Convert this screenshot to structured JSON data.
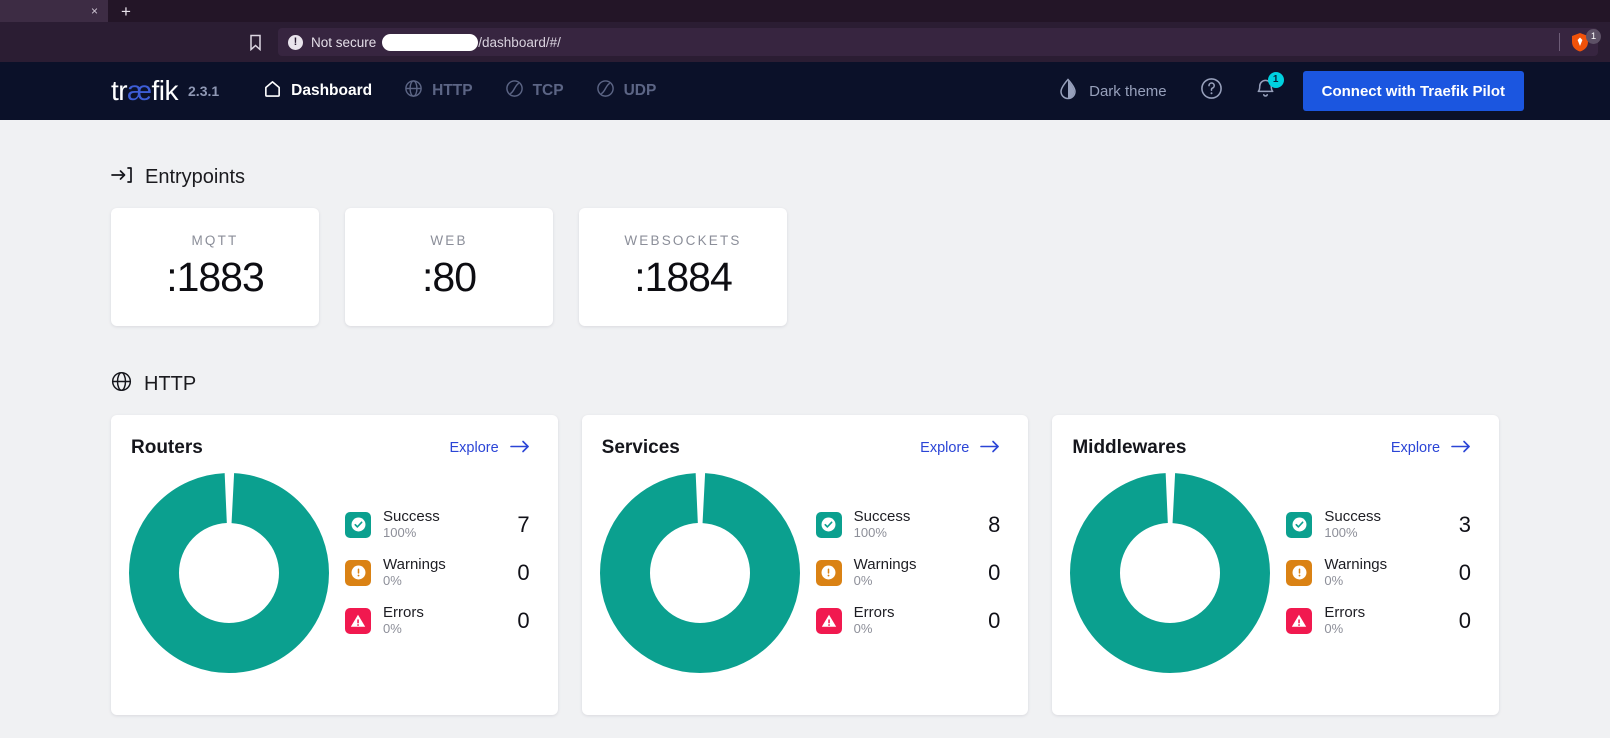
{
  "browser": {
    "tab_close_label": "×",
    "new_tab_label": "+",
    "bookmark_icon": "bookmark-icon",
    "security_label": "Not secure",
    "security_icon": "not-secure-icon",
    "url_suffix": "/dashboard/#/",
    "shield_icon": "brave-shield-icon",
    "shield_badge": "1"
  },
  "navbar": {
    "logo_pre": "tr",
    "logo_ae": "æ",
    "logo_post": "fik",
    "version": "2.3.1",
    "items": [
      {
        "label": "Dashboard",
        "icon": "home-icon",
        "active": true
      },
      {
        "label": "HTTP",
        "icon": "globe-icon",
        "active": false
      },
      {
        "label": "TCP",
        "icon": "tcp-icon",
        "active": false
      },
      {
        "label": "UDP",
        "icon": "udp-icon",
        "active": false
      }
    ],
    "theme_label": "Dark theme",
    "theme_icon": "half-droplet-icon",
    "help_icon": "help-circle-icon",
    "bell_icon": "bell-icon",
    "bell_badge": "1",
    "pilot_button": "Connect with Traefik Pilot",
    "accent_blue": "#1b56e0"
  },
  "entrypoints": {
    "section_title": "Entrypoints",
    "section_icon": "entrypoint-arrow-icon",
    "cards": [
      {
        "name": "MQTT",
        "port": ":1883"
      },
      {
        "name": "WEB",
        "port": ":80"
      },
      {
        "name": "WEBSOCKETS",
        "port": ":1884"
      }
    ]
  },
  "http": {
    "section_title": "HTTP",
    "section_icon": "globe-icon",
    "explore_label": "Explore",
    "panels": [
      {
        "title": "Routers",
        "stats": [
          {
            "label": "Success",
            "percent": "100%",
            "count": "7",
            "icon": "check-circle-icon",
            "color": "#0ba08f"
          },
          {
            "label": "Warnings",
            "percent": "0%",
            "count": "0",
            "icon": "exclamation-circle-icon",
            "color": "#da8214"
          },
          {
            "label": "Errors",
            "percent": "0%",
            "count": "0",
            "icon": "warning-triangle-icon",
            "color": "#f1194f"
          }
        ]
      },
      {
        "title": "Services",
        "stats": [
          {
            "label": "Success",
            "percent": "100%",
            "count": "8",
            "icon": "check-circle-icon",
            "color": "#0ba08f"
          },
          {
            "label": "Warnings",
            "percent": "0%",
            "count": "0",
            "icon": "exclamation-circle-icon",
            "color": "#da8214"
          },
          {
            "label": "Errors",
            "percent": "0%",
            "count": "0",
            "icon": "warning-triangle-icon",
            "color": "#f1194f"
          }
        ]
      },
      {
        "title": "Middlewares",
        "stats": [
          {
            "label": "Success",
            "percent": "100%",
            "count": "3",
            "icon": "check-circle-icon",
            "color": "#0ba08f"
          },
          {
            "label": "Warnings",
            "percent": "0%",
            "count": "0",
            "icon": "exclamation-circle-icon",
            "color": "#da8214"
          },
          {
            "label": "Errors",
            "percent": "0%",
            "count": "0",
            "icon": "warning-triangle-icon",
            "color": "#f1194f"
          }
        ]
      }
    ]
  },
  "chart_data": [
    {
      "type": "pie",
      "title": "Routers",
      "labels": [
        "Success",
        "Warnings",
        "Errors"
      ],
      "values": [
        7,
        0,
        0
      ],
      "percents": [
        100,
        0,
        0
      ],
      "colors": [
        "#0ba08f",
        "#da8214",
        "#f1194f"
      ],
      "legend": "right",
      "donut": true
    },
    {
      "type": "pie",
      "title": "Services",
      "labels": [
        "Success",
        "Warnings",
        "Errors"
      ],
      "values": [
        8,
        0,
        0
      ],
      "percents": [
        100,
        0,
        0
      ],
      "colors": [
        "#0ba08f",
        "#da8214",
        "#f1194f"
      ],
      "legend": "right",
      "donut": true
    },
    {
      "type": "pie",
      "title": "Middlewares",
      "labels": [
        "Success",
        "Warnings",
        "Errors"
      ],
      "values": [
        3,
        0,
        0
      ],
      "percents": [
        100,
        0,
        0
      ],
      "colors": [
        "#0ba08f",
        "#da8214",
        "#f1194f"
      ],
      "legend": "right",
      "donut": true
    }
  ]
}
